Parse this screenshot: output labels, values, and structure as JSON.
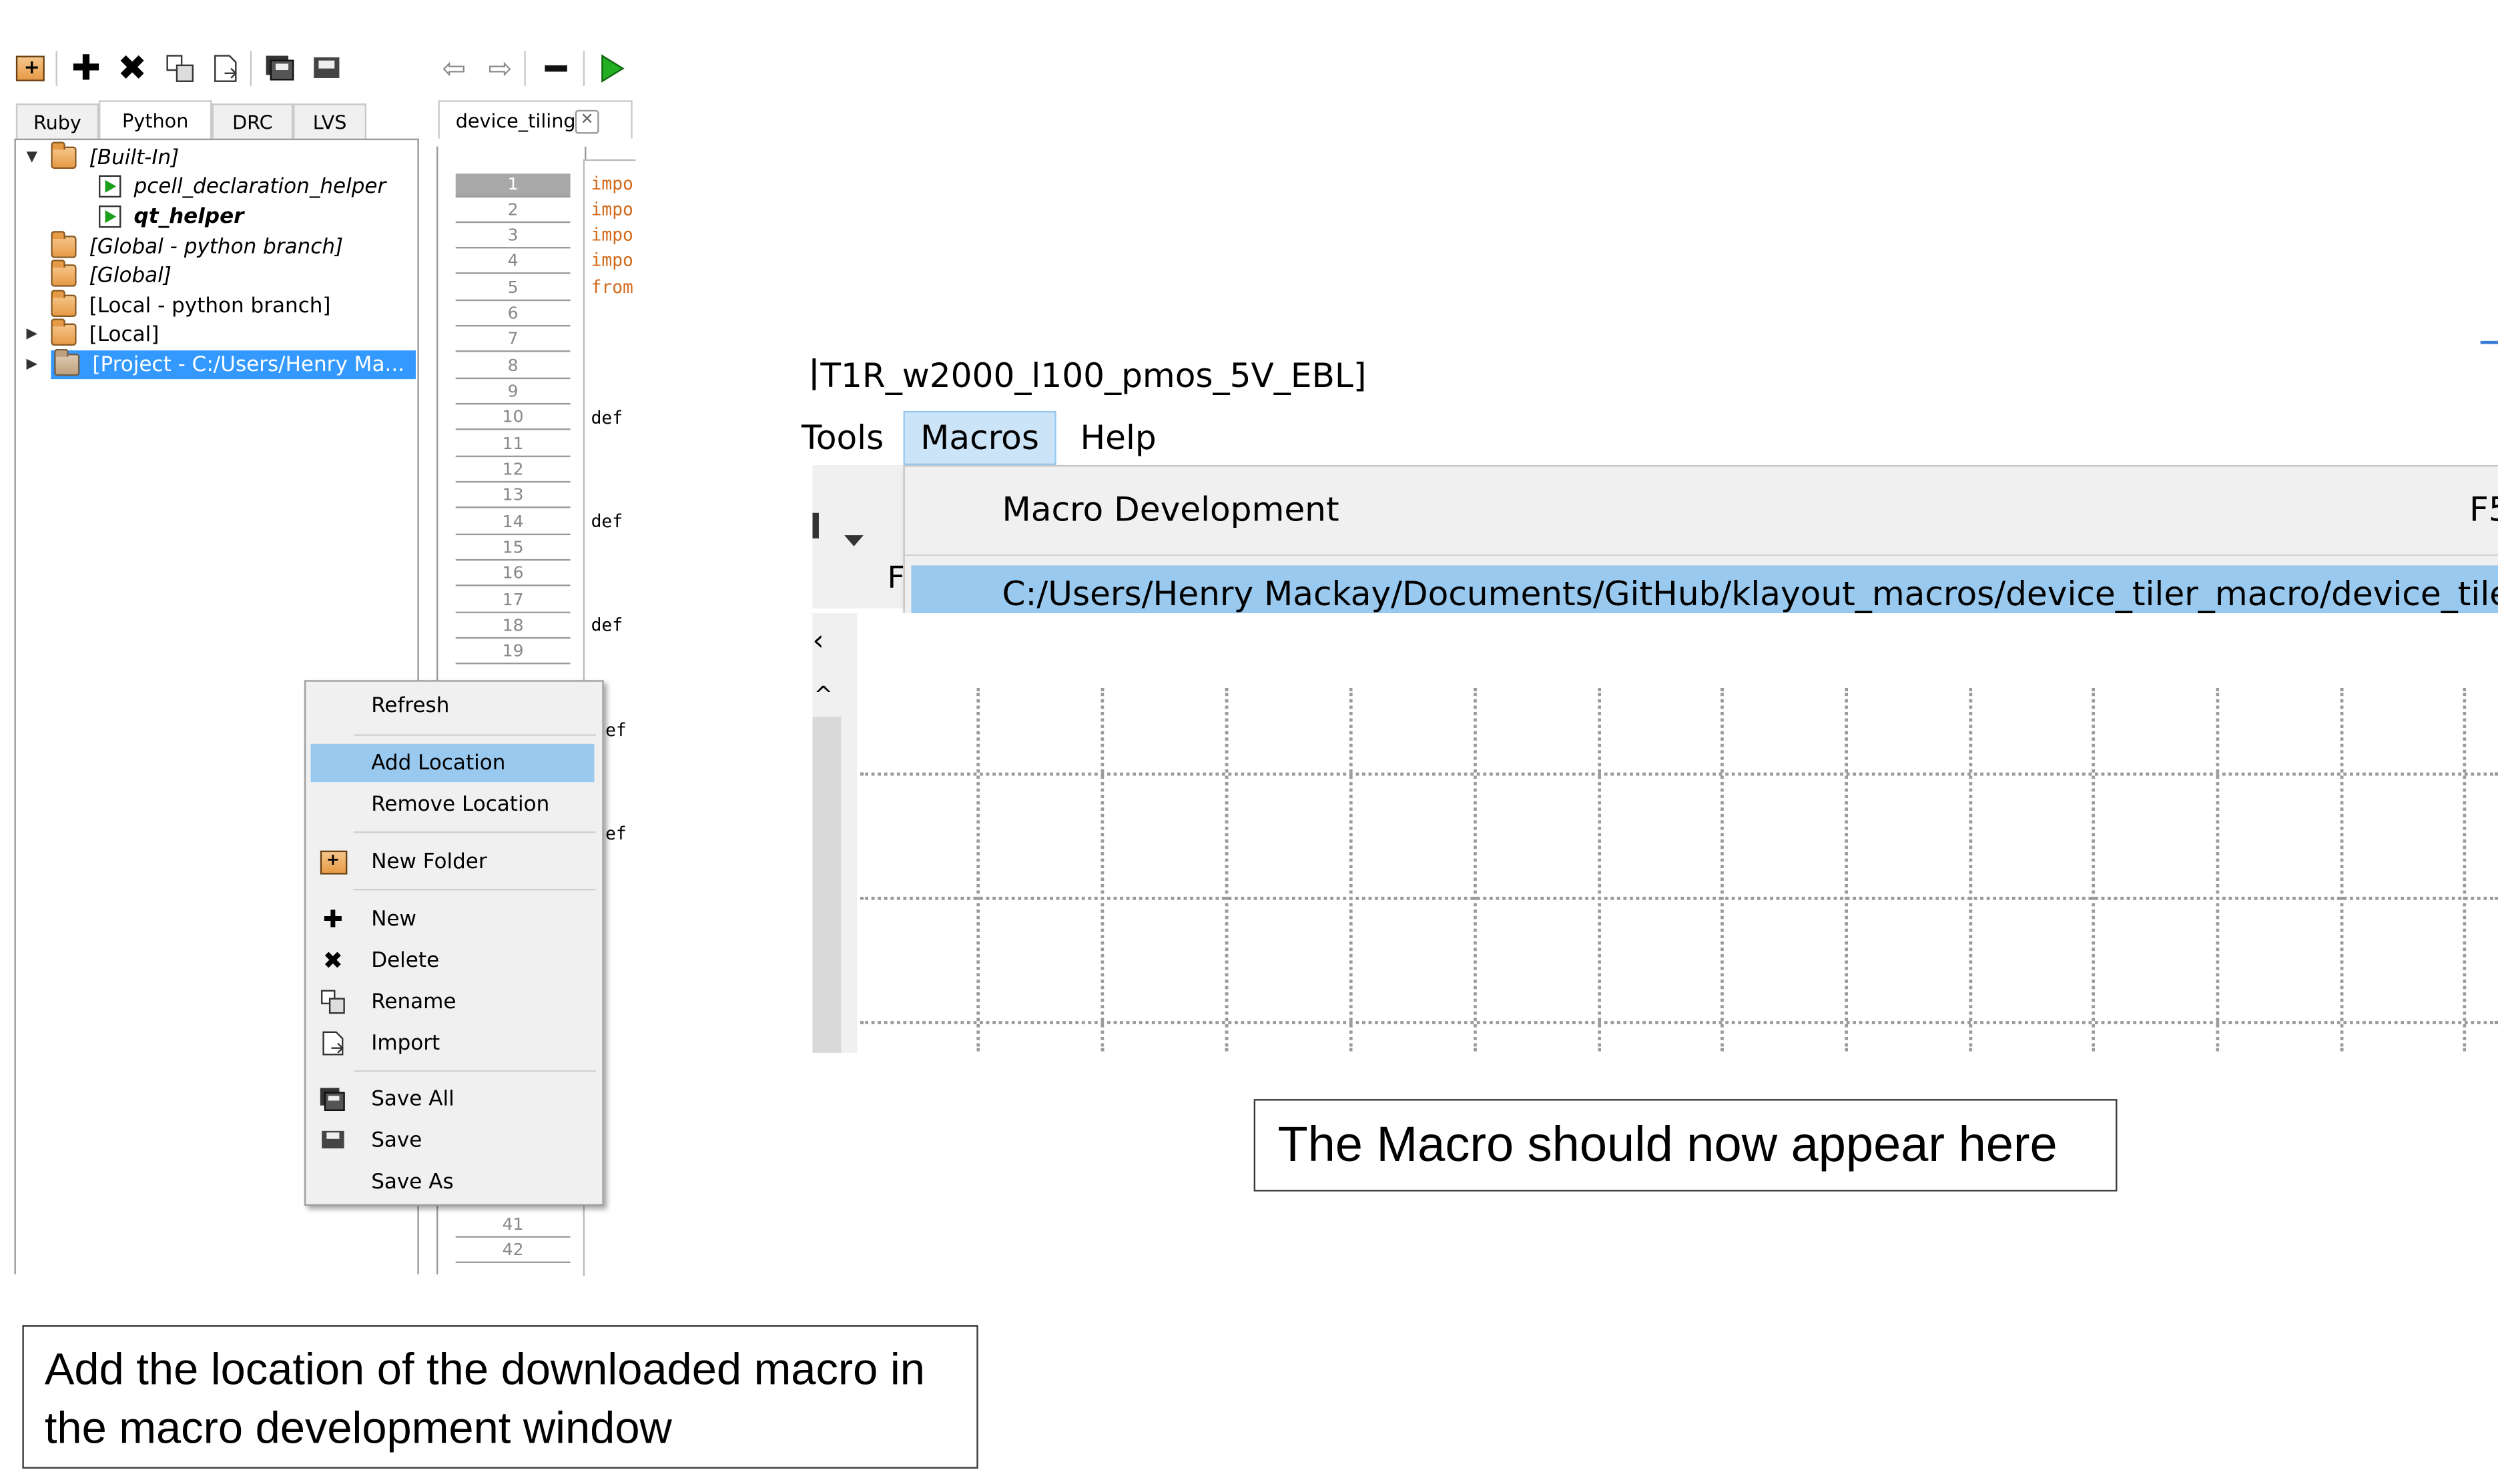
{
  "left_panel": {
    "tabs": [
      "Ruby",
      "Python",
      "DRC",
      "LVS"
    ],
    "active_tab": "Python",
    "editor_tab": "device_tiling",
    "tree": [
      {
        "label": "[Built-In]",
        "expanded": true
      },
      {
        "label": "pcell_declaration_helper"
      },
      {
        "label": "qt_helper"
      },
      {
        "label": "[Global - python branch]"
      },
      {
        "label": "[Global]"
      },
      {
        "label": "[Local - python branch]"
      },
      {
        "label": "[Local]"
      },
      {
        "label": "[Project - C:/Users/Henry Ma..."
      }
    ],
    "line_numbers": [
      "1",
      "2",
      "3",
      "4",
      "5",
      "6",
      "7",
      "8",
      "9",
      "10",
      "11",
      "12",
      "13",
      "14",
      "15",
      "16",
      "17",
      "18",
      "19",
      "41",
      "42"
    ],
    "code": {
      "l1": "impo",
      "l2": "impo",
      "l3": "impo",
      "l4": "impo",
      "l5": "from",
      "def": "def",
      "ef": "ef"
    },
    "context_menu": {
      "refresh": "Refresh",
      "add_location": "Add Location",
      "remove_location": "Remove Location",
      "new_folder": "New Folder",
      "new": "New",
      "delete": "Delete",
      "rename": "Rename",
      "import": "Import",
      "save_all": "Save All",
      "save": "Save",
      "save_as": "Save As"
    }
  },
  "right_panel": {
    "window_title": "T1R_w2000_l100_pmos_5V_EBL]",
    "menubar": {
      "tools": "Tools",
      "macros": "Macros",
      "help": "Help"
    },
    "macros_menu": {
      "macro_development": "Macro Development",
      "shortcut": "F5",
      "path": "C:/Users/Henry Mackay/Documents/GitHub/klayout_macros/device_tiler_macro/device_tiler.lym"
    },
    "toolbar_fragment": "F"
  },
  "notes": {
    "left": "Add the location of the downloaded macro in the macro development window",
    "right": "The Macro should now appear here"
  },
  "colors": {
    "selection": "#99c9ef",
    "tree_selection": "#3399ff",
    "code_keyword": "#d36a1b"
  }
}
